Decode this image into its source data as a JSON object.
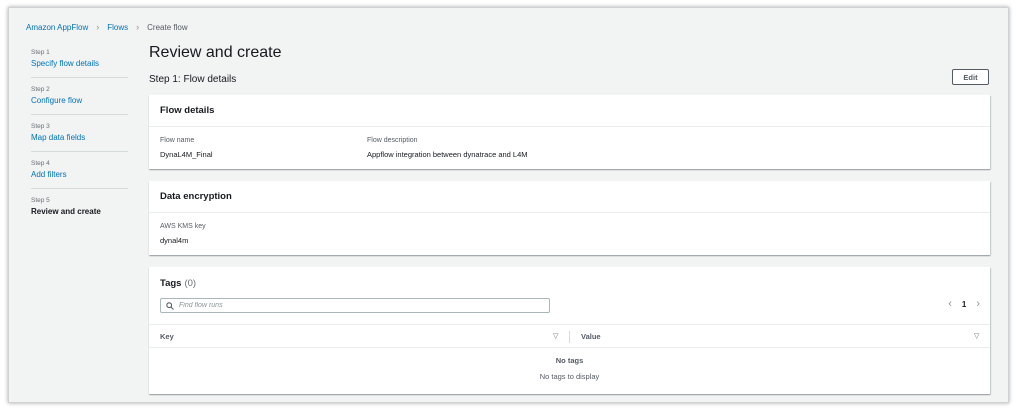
{
  "breadcrumb": {
    "items": [
      {
        "label": "Amazon AppFlow"
      },
      {
        "label": "Flows"
      },
      {
        "label": "Create flow"
      }
    ]
  },
  "steps": [
    {
      "number": "Step 1",
      "label": "Specify flow details"
    },
    {
      "number": "Step 2",
      "label": "Configure flow"
    },
    {
      "number": "Step 3",
      "label": "Map data fields"
    },
    {
      "number": "Step 4",
      "label": "Add filters"
    },
    {
      "number": "Step 5",
      "label": "Review and create"
    }
  ],
  "page": {
    "title": "Review and create",
    "step_heading": "Step 1: Flow details",
    "edit_label": "Edit"
  },
  "flow_details": {
    "header": "Flow details",
    "name_label": "Flow name",
    "name_value": "DynaL4M_Final",
    "description_label": "Flow description",
    "description_value": "Appflow integration between dynatrace and L4M"
  },
  "encryption": {
    "header": "Data encryption",
    "kms_label": "AWS KMS key",
    "kms_value": "dynal4m"
  },
  "tags": {
    "header": "Tags",
    "count": "(0)",
    "search_placeholder": "Find flow runs",
    "page": "1",
    "columns": [
      "Key",
      "Value"
    ],
    "empty_title": "No tags",
    "empty_subtitle": "No tags to display"
  },
  "colors": {
    "link": "#0073bb",
    "text": "#16191f",
    "muted": "#545b64",
    "background": "#f2f3f3"
  }
}
